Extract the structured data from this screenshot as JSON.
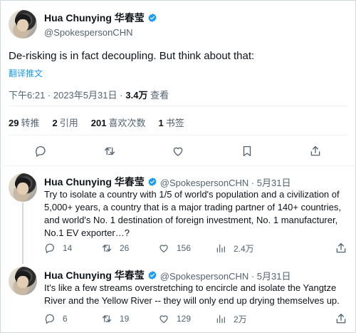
{
  "main_tweet": {
    "author_name": "Hua Chunying 华春莹",
    "handle": "@SpokespersonCHN",
    "text": "De-risking is in fact decoupling. But think about that:",
    "translate_label": "翻译推文",
    "timestamp": "下午6:21 · 2023年5月31日 ·",
    "views_count": "3.4万",
    "views_label": "查看",
    "stats": [
      {
        "num": "29",
        "label": "转推"
      },
      {
        "num": "2",
        "label": "引用"
      },
      {
        "num": "201",
        "label": "喜欢次数"
      },
      {
        "num": "1",
        "label": "书签"
      }
    ],
    "actions": [
      "reply-icon",
      "retweet-icon",
      "like-icon",
      "bookmark-icon",
      "share-icon"
    ]
  },
  "replies": [
    {
      "author_name": "Hua Chunying 华春莹",
      "handle_date": "@SpokespersonCHN · 5月31日",
      "text": "Try to isolate a country with 1/5 of world's population and a civilization of 5,000+ years, a country that is a major trading partner of 140+ countries, and world's No. 1 destination of foreign investment, No. 1 manufacturer, No.1 EV exporter…?",
      "reply_count": "14",
      "retweet_count": "26",
      "like_count": "156",
      "view_count": "2.4万"
    },
    {
      "author_name": "Hua Chunying 华春莹",
      "handle_date": "@SpokespersonCHN · 5月31日",
      "text": "It's like a few streams overstretching to encircle and isolate the Yangtze River and the Yellow River -- they will only end up drying themselves up.",
      "reply_count": "6",
      "retweet_count": "19",
      "like_count": "129",
      "view_count": "2万"
    }
  ],
  "colors": {
    "text": "#0f1419",
    "secondary": "#536471",
    "link": "#1d9bf0",
    "verified": "#1d9bf0",
    "divider": "#eff3f4"
  }
}
